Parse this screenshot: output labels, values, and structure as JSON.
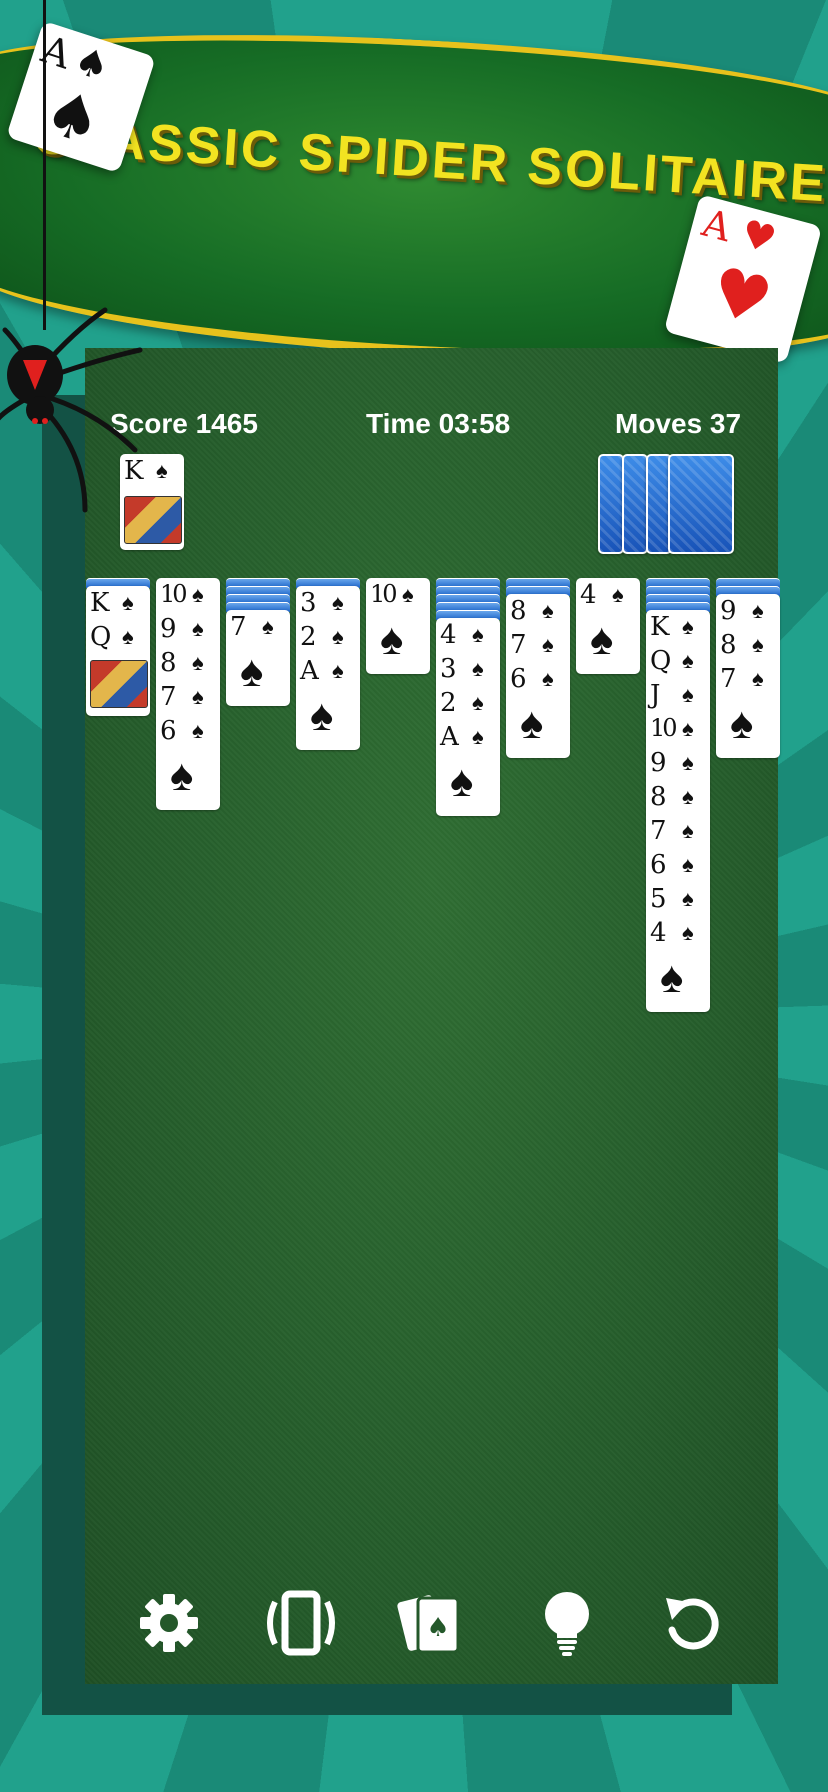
{
  "banner": {
    "title": "CLASSIC SPIDER SOLITAIRE"
  },
  "deco_cards": [
    {
      "rank": "A",
      "suit": "♠",
      "color": "#111111"
    },
    {
      "rank": "A",
      "suit": "♥",
      "color": "#e0201e"
    }
  ],
  "hud": {
    "score": "Score 1465",
    "time": "Time 03:58",
    "moves": "Moves 37"
  },
  "completed": [
    {
      "rank": "K",
      "suit": "♠"
    }
  ],
  "colors": {
    "felt": "#2a6330",
    "banner_gold": "#e7c21c",
    "title_yellow": "#f2e321",
    "background": "#1f9a86"
  },
  "tableau": [
    {
      "hidden": 1,
      "cards": [
        "K",
        "Q"
      ],
      "court_last": true
    },
    {
      "hidden": 0,
      "cards": [
        "10",
        "9",
        "8",
        "7",
        "6"
      ]
    },
    {
      "hidden": 4,
      "cards": [
        "7"
      ]
    },
    {
      "hidden": 1,
      "cards": [
        "3",
        "2",
        "A"
      ]
    },
    {
      "hidden": 0,
      "cards": [
        "10"
      ]
    },
    {
      "hidden": 5,
      "cards": [
        "4",
        "3",
        "2",
        "A"
      ]
    },
    {
      "hidden": 2,
      "cards": [
        "8",
        "7",
        "6"
      ]
    },
    {
      "hidden": 0,
      "cards": [
        "4"
      ]
    },
    {
      "hidden": 4,
      "cards": [
        "K",
        "Q",
        "J",
        "10",
        "9",
        "8",
        "7",
        "6",
        "5",
        "4"
      ]
    },
    {
      "hidden": 2,
      "cards": [
        "9",
        "8",
        "7"
      ]
    }
  ],
  "suit": "♠",
  "toolbar": [
    {
      "icon": "gear-icon"
    },
    {
      "icon": "rotate-phone-icon"
    },
    {
      "icon": "cards-icon"
    },
    {
      "icon": "lightbulb-icon"
    },
    {
      "icon": "undo-icon"
    }
  ]
}
